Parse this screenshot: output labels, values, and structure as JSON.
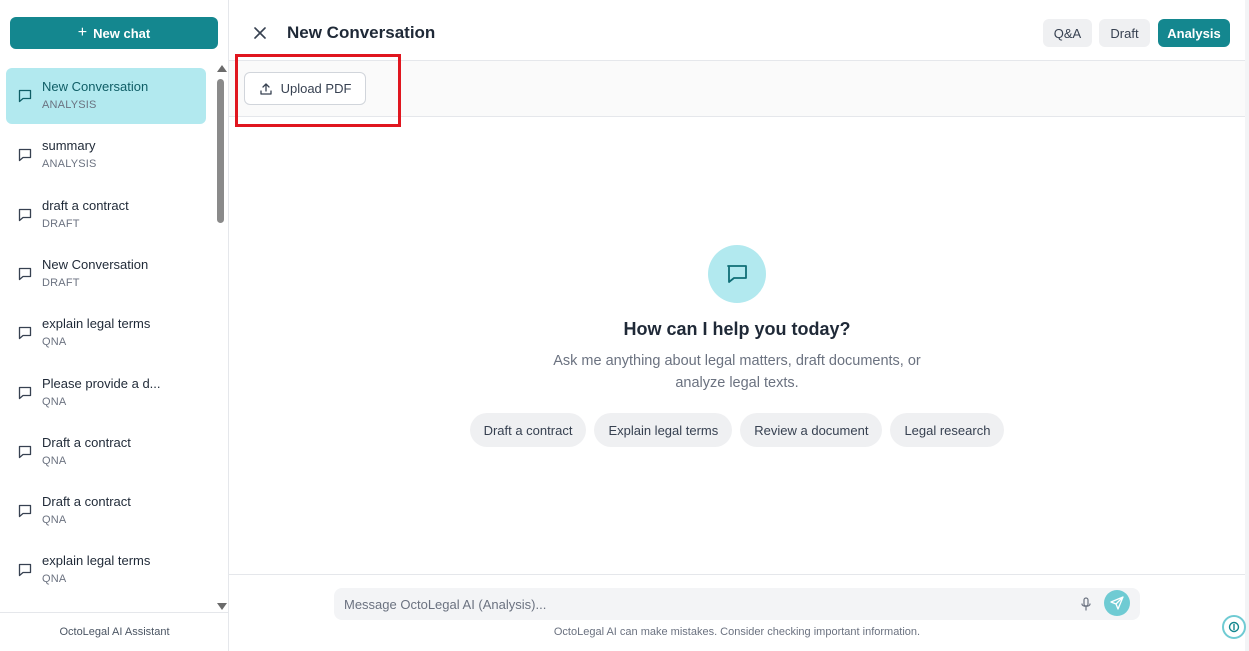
{
  "sidebar": {
    "new_chat_label": "New chat",
    "conversations": [
      {
        "title": "New Conversation",
        "mode": "ANALYSIS",
        "active": true
      },
      {
        "title": "summary",
        "mode": "ANALYSIS"
      },
      {
        "title": "draft a contract",
        "mode": "DRAFT"
      },
      {
        "title": "New Conversation",
        "mode": "DRAFT"
      },
      {
        "title": "explain legal terms",
        "mode": "QNA"
      },
      {
        "title": "Please provide a d...",
        "mode": "QNA"
      },
      {
        "title": "Draft a contract",
        "mode": "QNA"
      },
      {
        "title": "Draft a contract",
        "mode": "QNA"
      },
      {
        "title": "explain legal terms",
        "mode": "QNA"
      }
    ],
    "footer": "OctoLegal AI Assistant"
  },
  "header": {
    "title": "New Conversation",
    "modes": [
      "Q&A",
      "Draft",
      "Analysis"
    ],
    "active_mode": "Analysis"
  },
  "toolbar": {
    "upload_label": "Upload PDF"
  },
  "empty_state": {
    "title": "How can I help you today?",
    "subtitle": "Ask me anything about legal matters, draft documents, or analyze legal texts.",
    "suggestions": [
      "Draft a contract",
      "Explain legal terms",
      "Review a document",
      "Legal research"
    ]
  },
  "composer": {
    "placeholder": "Message OctoLegal AI (Analysis)...",
    "disclaimer": "OctoLegal AI can make mistakes. Consider checking important information."
  },
  "colors": {
    "accent": "#14878f",
    "accent_light": "#b2e9ef",
    "highlight": "#e0161f"
  }
}
